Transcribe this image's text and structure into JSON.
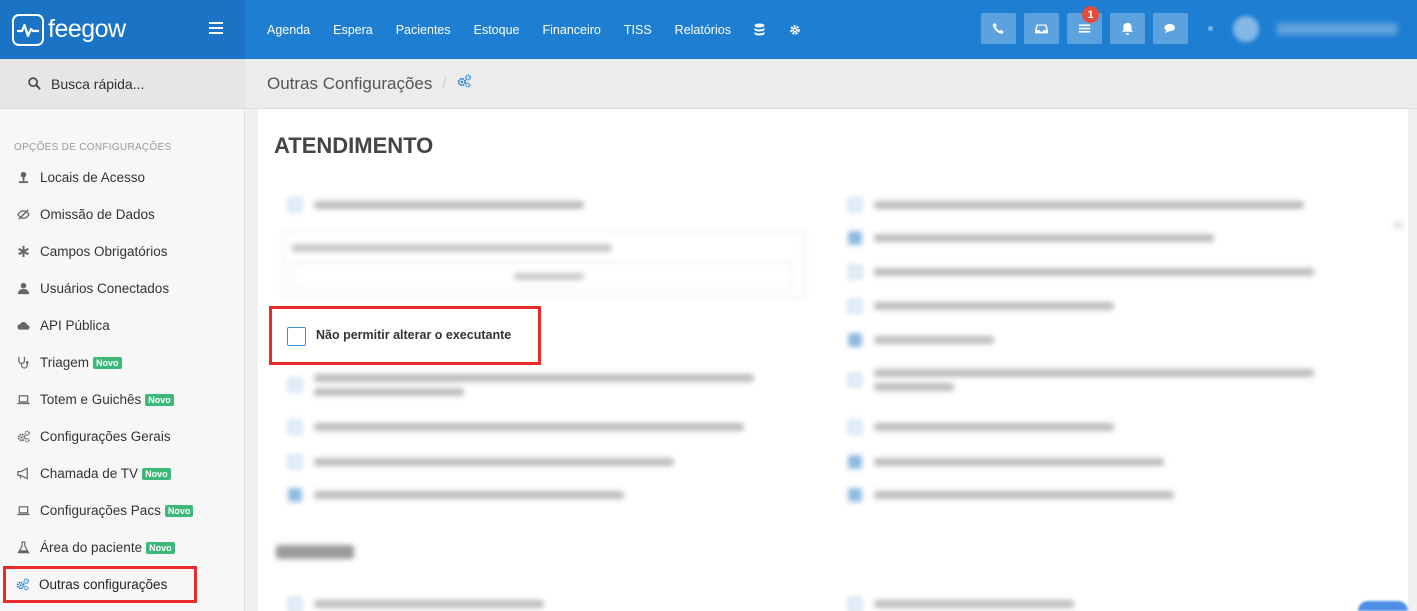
{
  "brand": {
    "name": "feegow"
  },
  "nav": {
    "items": [
      "Agenda",
      "Espera",
      "Pacientes",
      "Estoque",
      "Financeiro",
      "TISS",
      "Relatórios"
    ],
    "icons": [
      "database-icon",
      "gear-icon"
    ]
  },
  "toolbar": {
    "notification_count": "1"
  },
  "sidebar": {
    "search_label": "Busca rápida...",
    "section_title": "OPÇÕES DE CONFIGURAÇÕES",
    "novo_label": "Novo",
    "items": [
      {
        "label": "Locais de Acesso",
        "icon": "location-pin-icon",
        "novo": false
      },
      {
        "label": "Omissão de Dados",
        "icon": "eye-slash-icon",
        "novo": false
      },
      {
        "label": "Campos Obrigatórios",
        "icon": "asterisk-icon",
        "novo": false
      },
      {
        "label": "Usuários Conectados",
        "icon": "user-icon",
        "novo": false
      },
      {
        "label": "API Pública",
        "icon": "cloud-icon",
        "novo": false
      },
      {
        "label": "Triagem",
        "icon": "stethoscope-icon",
        "novo": true
      },
      {
        "label": "Totem e Guichês",
        "icon": "laptop-icon",
        "novo": true
      },
      {
        "label": "Configurações Gerais",
        "icon": "cogs-icon",
        "novo": false
      },
      {
        "label": "Chamada de TV",
        "icon": "bullhorn-icon",
        "novo": true
      },
      {
        "label": "Configurações Pacs",
        "icon": "laptop-icon",
        "novo": true
      },
      {
        "label": "Área do paciente",
        "icon": "flask-icon",
        "novo": true
      },
      {
        "label": "Outras configurações",
        "icon": "cogs-icon",
        "novo": false
      }
    ]
  },
  "breadcrumb": {
    "title": "Outras Configurações",
    "separator": "/"
  },
  "main": {
    "section_heading": "ATENDIMENTO",
    "highlighted_option": {
      "label": "Não permitir alterar o executante",
      "checked": false
    }
  },
  "colors": {
    "topbar": "#1e7ed2",
    "accent": "#1e7ed2",
    "highlight_border": "#e82a2a",
    "novo_badge": "#3cb878"
  }
}
